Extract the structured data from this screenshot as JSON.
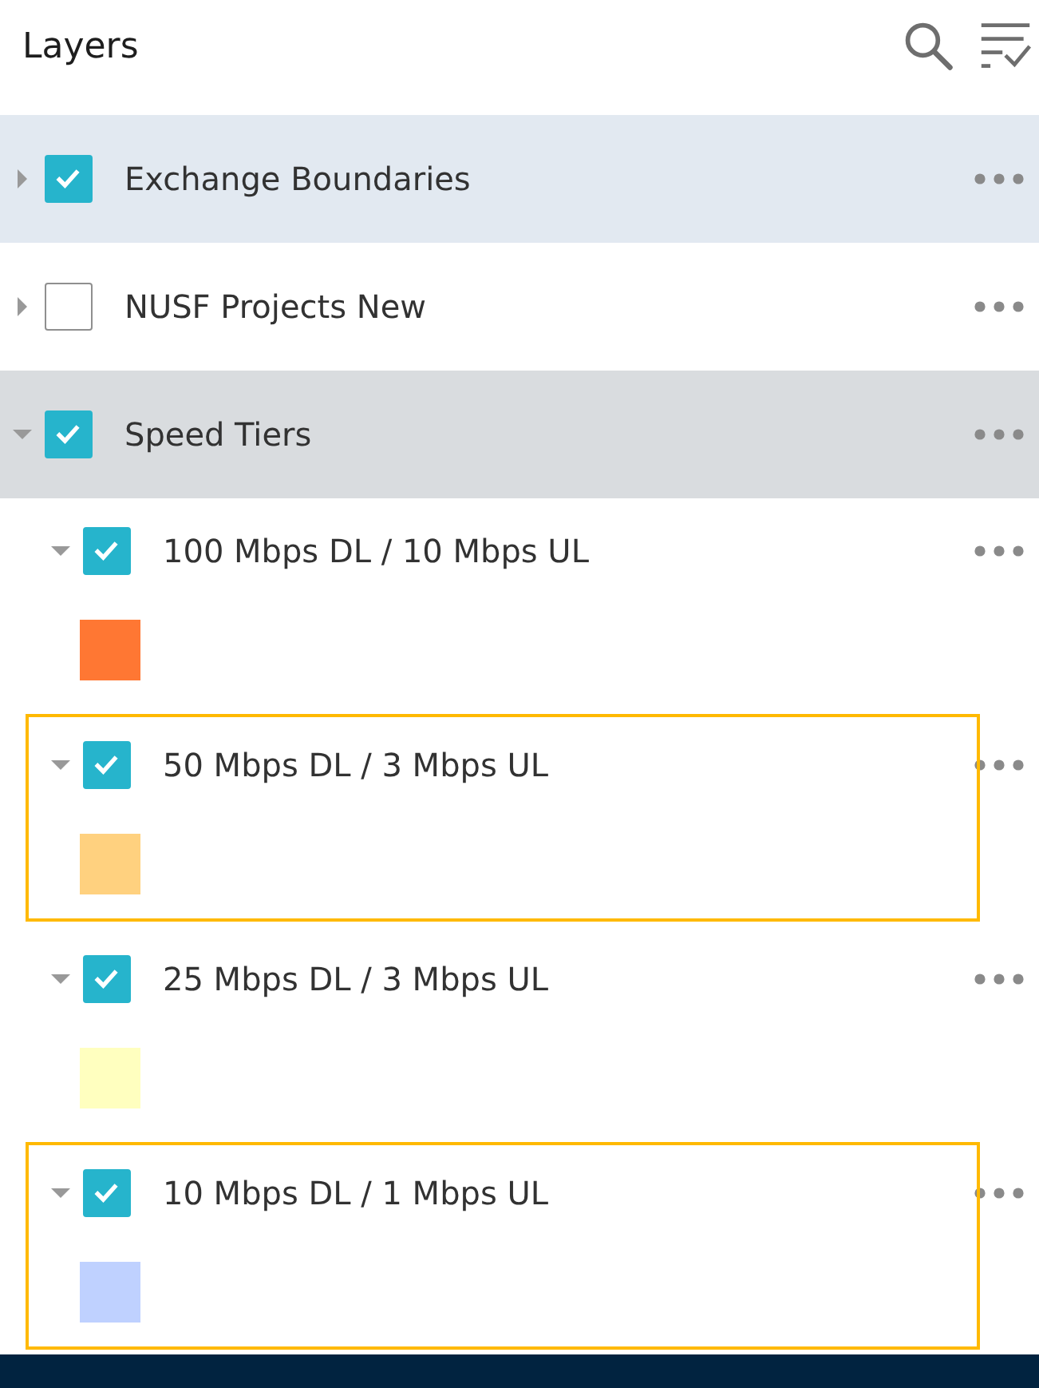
{
  "panel": {
    "title": "Layers"
  },
  "layers": [
    {
      "name": "Exchange Boundaries",
      "checked": true,
      "expanded": false,
      "selected": true,
      "hovered": false
    },
    {
      "name": "NUSF Projects New",
      "checked": false,
      "expanded": false,
      "selected": false,
      "hovered": false
    },
    {
      "name": "Speed Tiers",
      "checked": true,
      "expanded": true,
      "selected": false,
      "hovered": true,
      "children": [
        {
          "name": "100 Mbps DL / 10 Mbps UL",
          "checked": true,
          "expanded": true,
          "color": "#ff7733",
          "highlighted": false
        },
        {
          "name": "50 Mbps DL / 3 Mbps UL",
          "checked": true,
          "expanded": true,
          "color": "#ffd17f",
          "highlighted": true
        },
        {
          "name": "25 Mbps DL / 3 Mbps UL",
          "checked": true,
          "expanded": true,
          "color": "#ffffbf",
          "highlighted": false
        },
        {
          "name": "10 Mbps DL / 1 Mbps UL",
          "checked": true,
          "expanded": true,
          "color": "#bfd1ff",
          "highlighted": true
        }
      ]
    }
  ]
}
